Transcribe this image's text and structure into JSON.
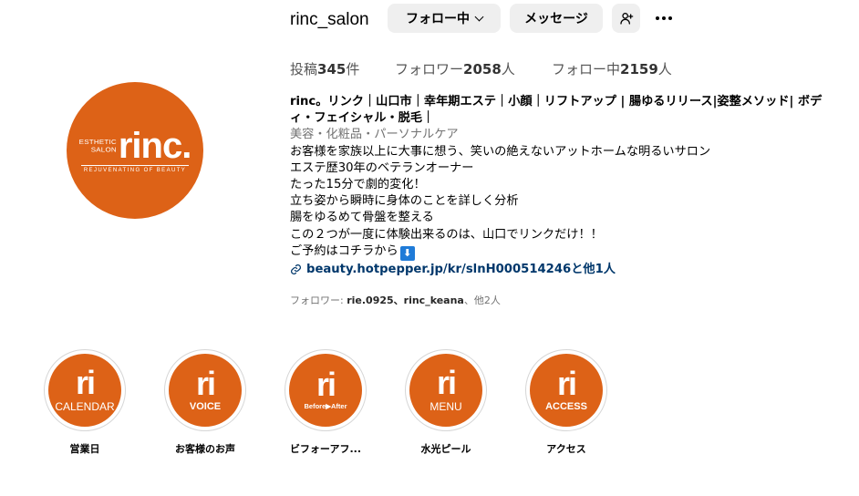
{
  "colors": {
    "brand": "#dd6217",
    "link": "#00376b"
  },
  "avatar": {
    "logo_small_line1": "ESTHETIC",
    "logo_small_line2": "SALON",
    "logo_big": "rinc.",
    "logo_tagline": "REJUVENATING OF BEAUTY"
  },
  "header": {
    "username": "rinc_salon",
    "follow_label": "フォロー中",
    "message_label": "メッセージ"
  },
  "stats": {
    "posts_label": "投稿",
    "posts_count": "345",
    "posts_unit": "件",
    "followers_label": "フォロワー",
    "followers_count": "2058",
    "followers_unit": "人",
    "following_label": "フォロー中",
    "following_count": "2159",
    "following_unit": "人"
  },
  "bio": {
    "name_line1": "rinc。リンク｜山口市｜幸年期エステ｜小顔｜リフトアップ | 腸ゆるリリース|姿整メソッド| ボデ",
    "name_line2": "ィ・フェイシャル・脱毛｜",
    "category": "美容・化粧品・パーソナルケア",
    "lines": [
      "お客様を家族以上に大事に想う、笑いの絶えないアットホームな明るいサロン",
      "エステ歴30年のベテランオーナー",
      "たった15分で劇的変化！",
      "立ち姿から瞬時に身体のことを詳しく分析",
      "腸をゆるめて骨盤を整える",
      "この２つが一度に体験出来るのは、山口でリンクだけ！！"
    ],
    "reserve_line": "ご予約はコチラから",
    "reserve_emoji": "⬇",
    "link_text": "beauty.hotpepper.jp/kr/slnH000514246と他1人"
  },
  "followed_by": {
    "prefix": "フォロワー: ",
    "names": "rie.0925、rinc_keana",
    "suffix": "、他2人"
  },
  "highlights": [
    {
      "icon_text": "ri",
      "sub": "CALENDAR",
      "title": "営業日"
    },
    {
      "icon_text": "ri",
      "sub": "VOICE",
      "title": "お客様のお声"
    },
    {
      "icon_text": "ri",
      "sub": "Before▶After",
      "title": "ビフォーアフ..."
    },
    {
      "icon_text": "ri",
      "sub": "MENU",
      "title": "水光ピール"
    },
    {
      "icon_text": "ri",
      "sub": "ACCESS",
      "title": "アクセス"
    }
  ]
}
